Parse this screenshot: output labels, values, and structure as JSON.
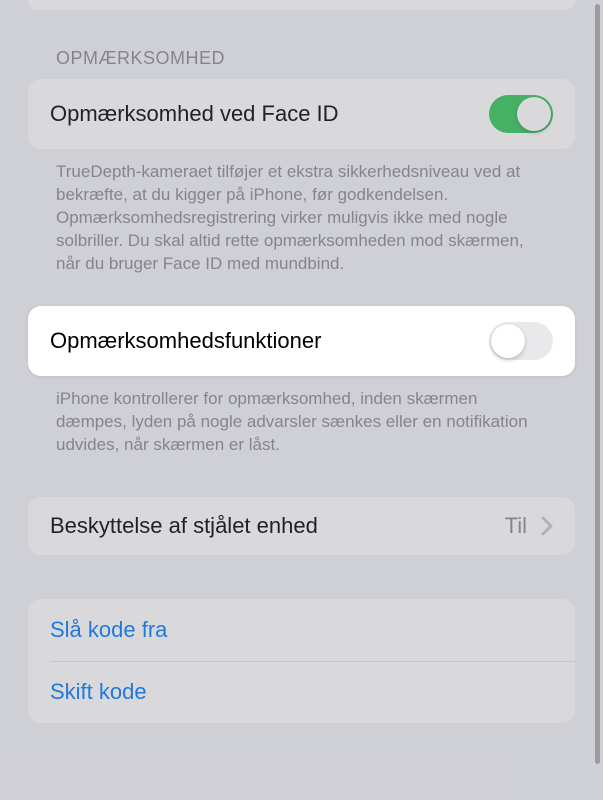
{
  "sections": {
    "attention": {
      "header": "OPMÆRKSOMHED",
      "faceid_row": {
        "label": "Opmærksomhed ved Face ID",
        "on": true
      },
      "faceid_footer": "TrueDepth-kameraet tilføjer et ekstra sikkerhedsniveau ved at bekræfte, at du kigger på iPhone, før godkendelsen. Opmærksomhedsregistrering virker muligvis ikke med nogle solbriller. Du skal altid rette opmærksomheden mod skærmen, når du bruger Face ID med mundbind.",
      "features_row": {
        "label": "Opmærksomhedsfunktioner",
        "on": false
      },
      "features_footer": "iPhone kontrollerer for opmærksomhed, inden skærmen dæmpes, lyden på nogle advarsler sænkes eller en notifikation udvides, når skærmen er låst."
    },
    "stolen": {
      "label": "Beskyttelse af stjålet enhed",
      "value": "Til"
    },
    "passcode": {
      "disable_label": "Slå kode fra",
      "change_label": "Skift kode"
    }
  },
  "colors": {
    "link": "#007aff",
    "toggle_on": "#34c759"
  }
}
